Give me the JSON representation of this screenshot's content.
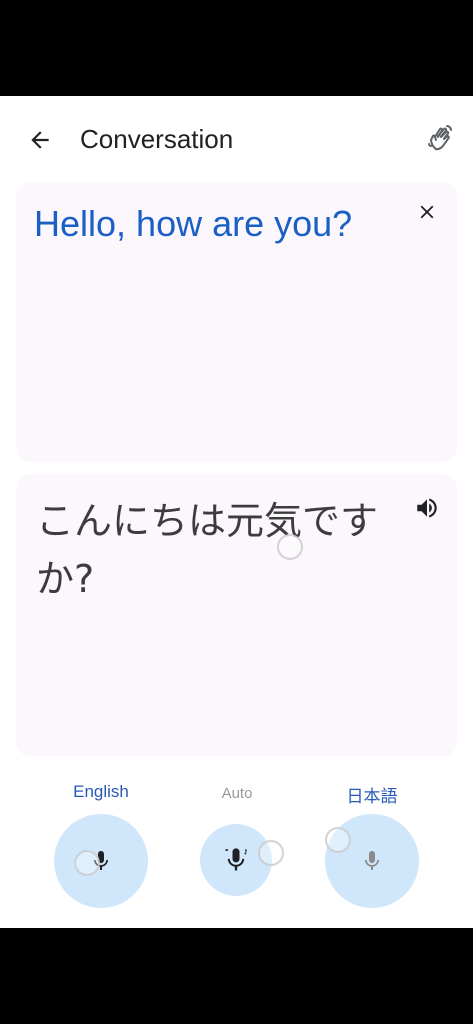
{
  "header": {
    "title": "Conversation",
    "back_icon": "arrow-left-icon",
    "wave_icon": "hand-wave-icon"
  },
  "source_card": {
    "text": "Hello, how are you?",
    "close_icon": "close-icon",
    "text_color": "#1a5fc4"
  },
  "target_card": {
    "text": "こんにちは元気ですか?",
    "speaker_icon": "speaker-icon",
    "text_color": "#3c3c3c"
  },
  "languages": {
    "left": "English",
    "middle": "Auto",
    "right": "日本語"
  },
  "colors": {
    "accent": "#2a5ab8",
    "mic_bg": "#cfe6fb",
    "card_bg": "#fcf7fc"
  }
}
